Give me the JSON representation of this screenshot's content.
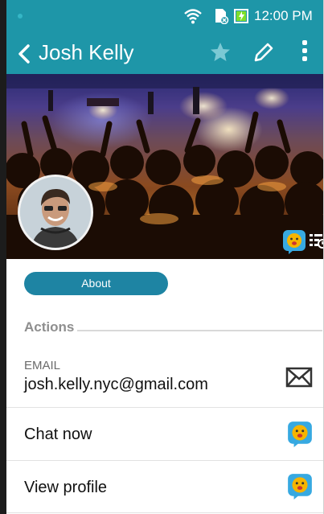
{
  "status_bar": {
    "time": "12:00 PM",
    "icons": [
      "wifi-icon",
      "sim-card-icon",
      "battery-charging-icon"
    ]
  },
  "app_bar": {
    "back_icon": "chevron-left-icon",
    "title": "Josh Kelly",
    "actions": [
      "star-icon",
      "pencil-icon",
      "more-vertical-icon"
    ]
  },
  "profile": {
    "avatar_icon": "avatar",
    "badge_icon": "chat-bubble-icon",
    "timeline_icon": "timeline-icon"
  },
  "about_button": "About",
  "actions_section": {
    "title": "Actions",
    "email": {
      "label": "EMAIL",
      "value": "josh.kelly.nyc@gmail.com",
      "icon": "mail-icon"
    },
    "items": [
      {
        "label": "Chat now",
        "icon": "chat-bubble-icon"
      },
      {
        "label": "View profile",
        "icon": "chat-bubble-icon"
      }
    ]
  },
  "colors": {
    "accent": "#1e96a8",
    "button": "#1e84a3",
    "badge_blue": "#37a9e1",
    "badge_face": "#f6b400"
  }
}
